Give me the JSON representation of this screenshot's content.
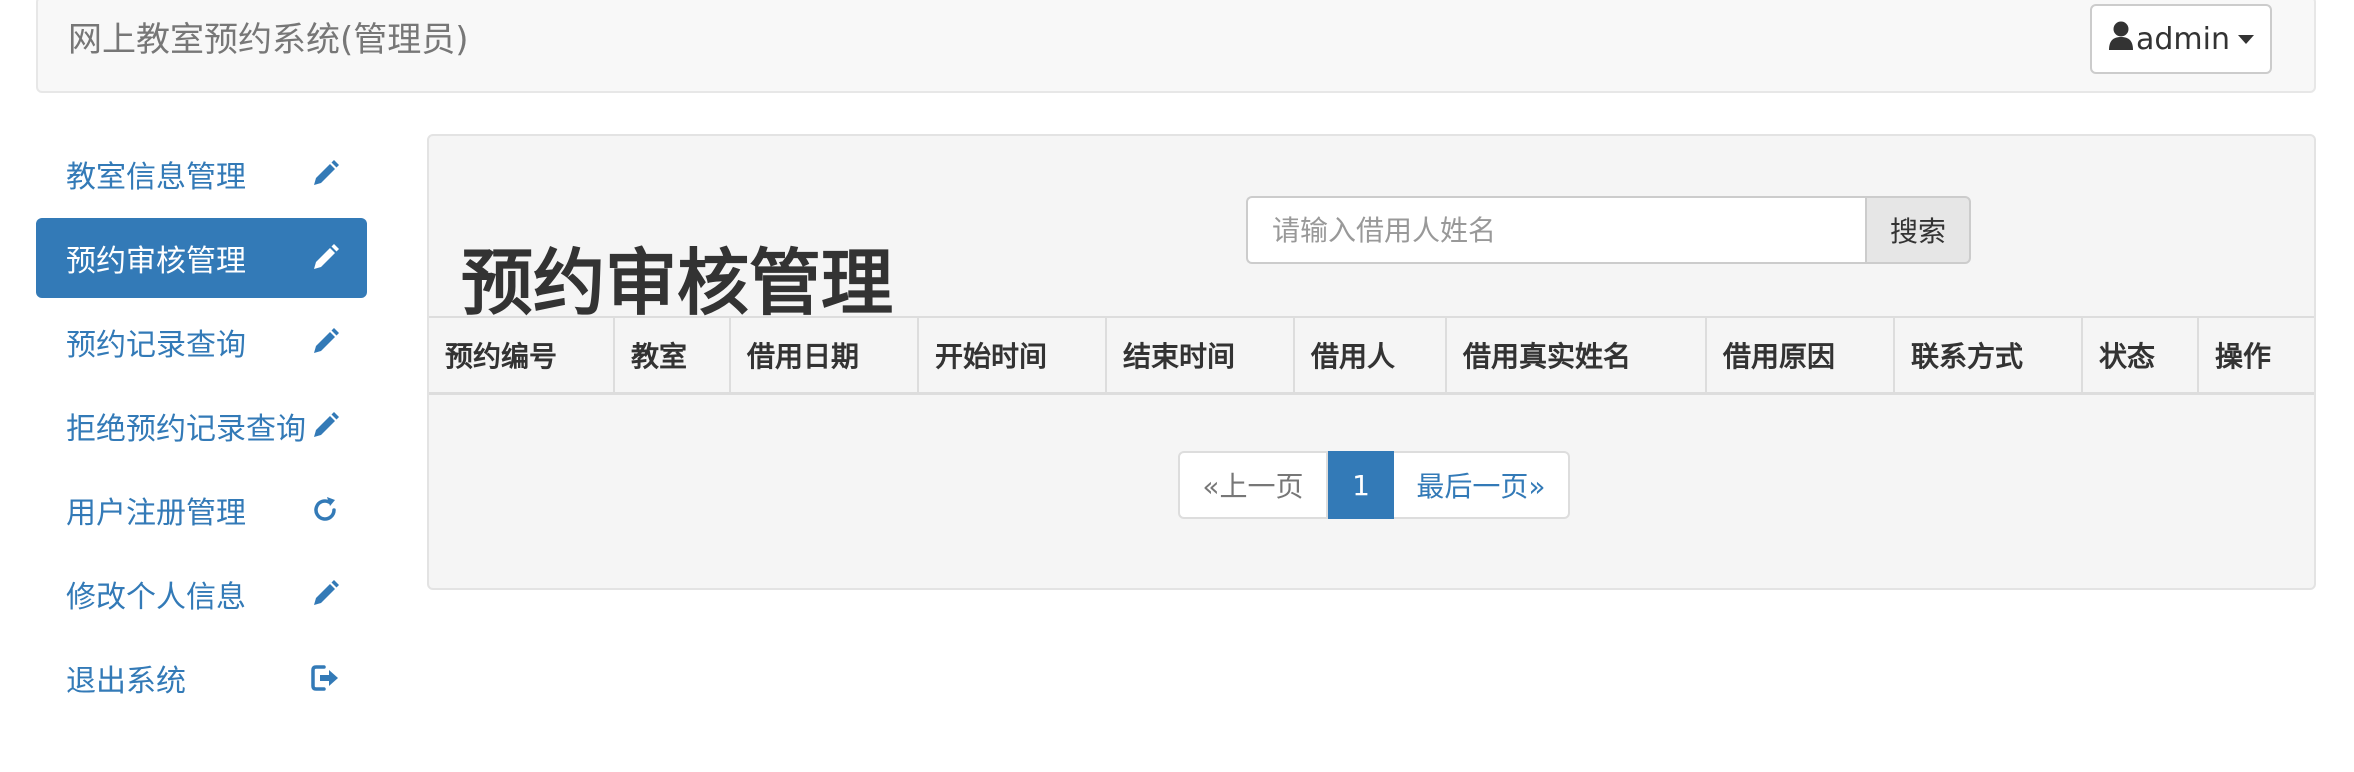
{
  "navbar": {
    "brand": "网上教室预约系统(管理员)",
    "user_label": "admin",
    "user_icon": "user-icon"
  },
  "sidebar": {
    "items": [
      {
        "label": "教室信息管理",
        "icon": "pencil-icon",
        "active": false
      },
      {
        "label": "预约审核管理",
        "icon": "pencil-icon",
        "active": true
      },
      {
        "label": "预约记录查询",
        "icon": "pencil-icon",
        "active": false
      },
      {
        "label": "拒绝预约记录查询",
        "icon": "pencil-icon",
        "active": false
      },
      {
        "label": "用户注册管理",
        "icon": "refresh-icon",
        "active": false
      },
      {
        "label": "修改个人信息",
        "icon": "pencil-icon",
        "active": false
      },
      {
        "label": "退出系统",
        "icon": "logout-icon",
        "active": false
      }
    ]
  },
  "main": {
    "title": "预约审核管理",
    "search": {
      "placeholder": "请输入借用人姓名",
      "value": "",
      "button_label": "搜索"
    },
    "table": {
      "columns": [
        "预约编号",
        "教室",
        "借用日期",
        "开始时间",
        "结束时间",
        "借用人",
        "借用真实姓名",
        "借用原因",
        "联系方式",
        "状态",
        "操作"
      ],
      "rows": []
    },
    "pagination": {
      "prev_label": "«上一页",
      "current_page": "1",
      "last_label": "最后一页»"
    }
  },
  "colors": {
    "primary": "#337ab7",
    "navbar_bg": "#f8f8f8",
    "panel_bg": "#f5f5f5"
  }
}
